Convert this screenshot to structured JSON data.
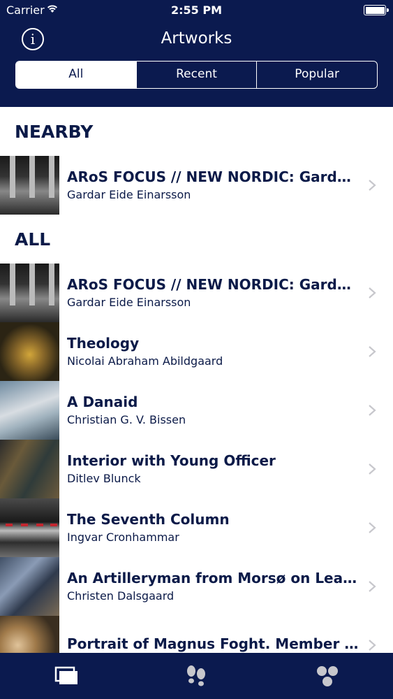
{
  "status_bar": {
    "carrier": "Carrier",
    "time": "2:55 PM"
  },
  "nav": {
    "title": "Artworks",
    "info_icon": "info-icon"
  },
  "segments": [
    {
      "label": "All",
      "active": true
    },
    {
      "label": "Recent",
      "active": false
    },
    {
      "label": "Popular",
      "active": false
    }
  ],
  "sections": {
    "nearby": {
      "title": "NEARBY",
      "items": [
        {
          "title": "ARoS FOCUS // NEW NORDIC: Gardar…",
          "artist": "Gardar Eide Einarsson"
        }
      ]
    },
    "all": {
      "title": "ALL",
      "items": [
        {
          "title": "ARoS FOCUS // NEW NORDIC: Gardar…",
          "artist": "Gardar Eide Einarsson"
        },
        {
          "title": "Theology",
          "artist": "Nicolai Abraham Abildgaard"
        },
        {
          "title": "A Danaid",
          "artist": "Christian G. V. Bissen"
        },
        {
          "title": "Interior with Young Officer",
          "artist": "Ditlev Blunck"
        },
        {
          "title": "The Seventh Column",
          "artist": "Ingvar Cronhammar"
        },
        {
          "title": "An Artilleryman from Morsø on Leave…",
          "artist": "Christen Dalsgaard"
        },
        {
          "title": "Portrait of Magnus Foght. Member of…",
          "artist": ""
        }
      ]
    }
  },
  "tab_bar": [
    "artworks-tab-icon",
    "footsteps-tab-icon",
    "dots-tab-icon"
  ],
  "colors": {
    "navy": "#0b1a4f",
    "text": "#0b1a48",
    "chevron": "#c7c7cc"
  }
}
